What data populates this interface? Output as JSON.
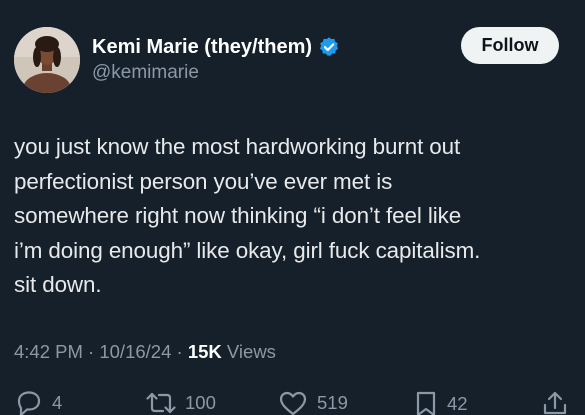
{
  "author": {
    "display_name": "Kemi Marie (they/them)",
    "handle": "@kemimarie",
    "verified": true,
    "verified_color": "#1d9bf0"
  },
  "follow_button": {
    "label": "Follow"
  },
  "tweet": {
    "lines": [
      "you just know the most hardworking burnt out",
      "perfectionist person you’ve ever met is",
      "somewhere right now thinking “i don’t feel like",
      "i’m doing enough” like okay, girl fuck capitalism.",
      "sit down."
    ]
  },
  "meta": {
    "time": "4:42 PM",
    "separator": " · ",
    "date": "10/16/24",
    "views_count": "15K",
    "views_label": "Views"
  },
  "actions": {
    "reply": {
      "icon": "reply-icon",
      "count": "4"
    },
    "retweet": {
      "icon": "retweet-icon",
      "count": "100"
    },
    "like": {
      "icon": "heart-icon",
      "count": "519"
    },
    "bookmark": {
      "icon": "bookmark-icon",
      "count": "42"
    },
    "share": {
      "icon": "share-icon"
    }
  },
  "colors": {
    "background": "#15202b",
    "text": "#e7e9ea",
    "secondary": "#8b98a5",
    "button_bg": "#eff3f4",
    "button_text": "#0f1419"
  }
}
